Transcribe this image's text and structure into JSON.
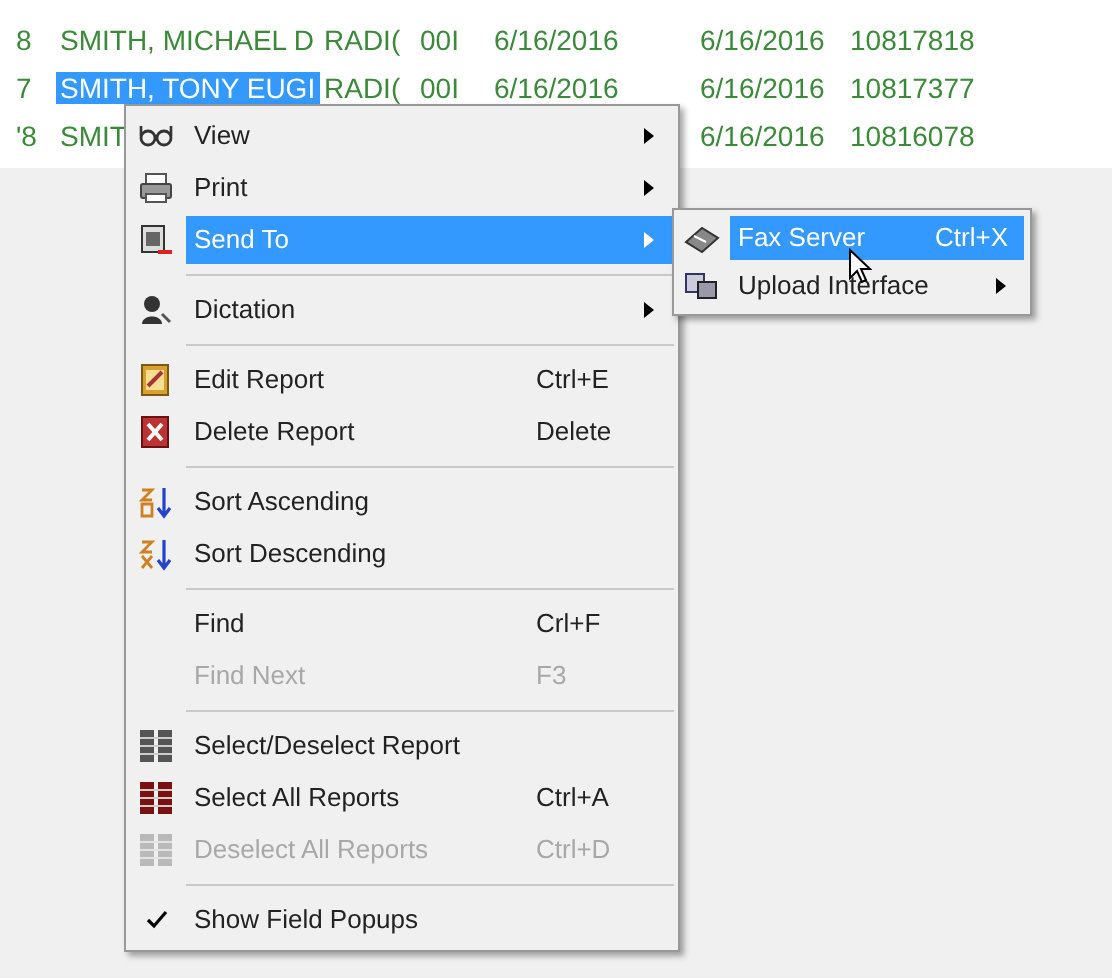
{
  "rows": [
    {
      "cells": [
        "8",
        "SMITH, MICHAEL D",
        "RADI(",
        "00I",
        "6/16/2016",
        "6/16/2016",
        "10817818"
      ],
      "selected": false
    },
    {
      "cells": [
        "7",
        "SMITH, TONY EUGI",
        "RADI(",
        "00I",
        "6/16/2016",
        "6/16/2016",
        "10817377"
      ],
      "selected": true
    },
    {
      "cells": [
        "'8",
        "SMIT",
        "",
        "",
        "",
        "6/16/2016",
        "10816078"
      ],
      "selected": false
    }
  ],
  "context_menu": {
    "items": [
      {
        "kind": "item",
        "label": "View",
        "submenu": true,
        "selected": false,
        "disabled": false
      },
      {
        "kind": "item",
        "label": "Print",
        "submenu": true,
        "selected": false,
        "disabled": false
      },
      {
        "kind": "item",
        "label": "Send To",
        "submenu": true,
        "selected": true,
        "disabled": false
      },
      {
        "kind": "separator"
      },
      {
        "kind": "item",
        "label": "Dictation",
        "submenu": true,
        "selected": false,
        "disabled": false
      },
      {
        "kind": "separator"
      },
      {
        "kind": "item",
        "label": "Edit Report",
        "shortcut": "Ctrl+E",
        "selected": false,
        "disabled": false
      },
      {
        "kind": "item",
        "label": "Delete Report",
        "shortcut": "Delete",
        "selected": false,
        "disabled": false
      },
      {
        "kind": "separator"
      },
      {
        "kind": "item",
        "label": "Sort Ascending",
        "selected": false,
        "disabled": false
      },
      {
        "kind": "item",
        "label": "Sort Descending",
        "selected": false,
        "disabled": false
      },
      {
        "kind": "separator"
      },
      {
        "kind": "item",
        "label": "Find",
        "shortcut": "Crl+F",
        "selected": false,
        "disabled": false
      },
      {
        "kind": "item",
        "label": "Find Next",
        "shortcut": "F3",
        "selected": false,
        "disabled": true
      },
      {
        "kind": "separator"
      },
      {
        "kind": "item",
        "label": "Select/Deselect Report",
        "selected": false,
        "disabled": false
      },
      {
        "kind": "item",
        "label": "Select All Reports",
        "shortcut": "Ctrl+A",
        "selected": false,
        "disabled": false
      },
      {
        "kind": "item",
        "label": "Deselect All Reports",
        "shortcut": "Ctrl+D",
        "selected": false,
        "disabled": true
      },
      {
        "kind": "separator"
      },
      {
        "kind": "check",
        "label": "Show Field Popups",
        "checked": true,
        "selected": false,
        "disabled": false
      }
    ]
  },
  "submenu": {
    "items": [
      {
        "label": "Fax Server",
        "shortcut": "Ctrl+X",
        "submenu": false,
        "selected": true
      },
      {
        "label": "Upload Interface",
        "submenu": true,
        "selected": false
      }
    ]
  }
}
